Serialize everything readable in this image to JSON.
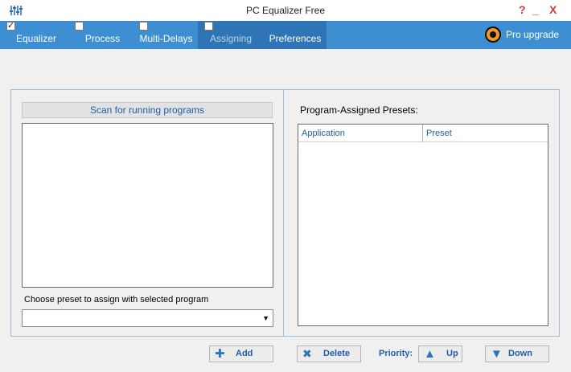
{
  "window": {
    "title": "PC Equalizer Free",
    "help_label": "?",
    "minimize_label": "_",
    "close_label": "X"
  },
  "tabs": [
    {
      "label": "Equalizer",
      "checked": true
    },
    {
      "label": "Process",
      "checked": false
    },
    {
      "label": "Multi-Delays",
      "checked": false
    },
    {
      "label": "Assigning",
      "checked": false,
      "active": true
    },
    {
      "label": "Preferences"
    }
  ],
  "pro_upgrade": {
    "label": "Pro upgrade"
  },
  "left_panel": {
    "scan_button": "Scan for running programs",
    "choose_label": "Choose preset to assign with selected program",
    "preset_value": ""
  },
  "right_panel": {
    "title": "Program-Assigned Presets:",
    "columns": [
      "Application",
      "Preset"
    ]
  },
  "bottom": {
    "add": "Add",
    "delete": "Delete",
    "priority": "Priority:",
    "up": "Up",
    "down": "Down"
  },
  "colors": {
    "accent": "#3d8fd1",
    "accent_dark": "#2f74b4",
    "text_blue": "#1f5fa8",
    "window_controls": "#d23b3b"
  },
  "icons": [
    "equalizer-sliders-icon",
    "pro-upgrade-logo-icon",
    "plus-icon",
    "delete-x-icon",
    "arrow-up-icon",
    "arrow-down-icon",
    "dropdown-arrow-icon"
  ]
}
